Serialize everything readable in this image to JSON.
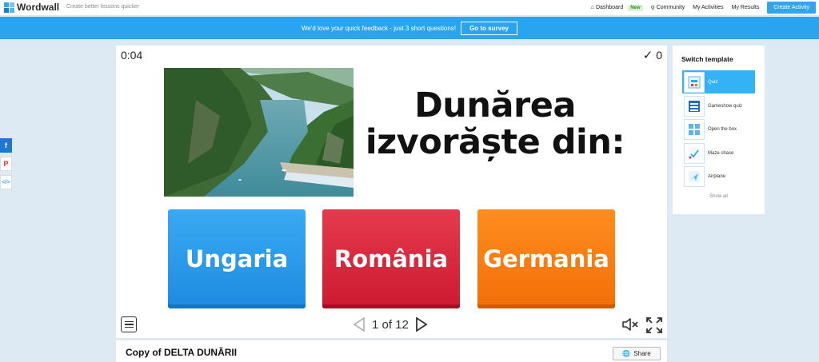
{
  "topbar": {
    "logo": "Wordwall",
    "tagline": "Create better lessons quicker",
    "nav": {
      "dashboard": "Dashboard",
      "new_badge": "New",
      "community": "Community",
      "my_activities": "My Activities",
      "my_results": "My Results",
      "create_activity": "Create Activity"
    }
  },
  "banner": {
    "text": "We'd love your quick feedback - just 3 short questions!",
    "button": "Go to survey"
  },
  "game": {
    "timer": "0:04",
    "score": "0",
    "question_line1": "Dunărea",
    "question_line2": "izvorăște din:",
    "answers": [
      "Ungaria",
      "România",
      "Germania"
    ],
    "pager": "1 of 12"
  },
  "activity": {
    "title": "Copy of DELTA DUNĂRII",
    "share": "Share"
  },
  "switcher": {
    "title": "Switch template",
    "templates": [
      "Quiz",
      "Gameshow quiz",
      "Open the box",
      "Maze chase",
      "Airplane"
    ],
    "show_all": "Show all"
  },
  "colors": {
    "accent": "#2aa4ee",
    "answer_blue": "#2196ea",
    "answer_red": "#d92238",
    "answer_orange": "#f57a10"
  }
}
